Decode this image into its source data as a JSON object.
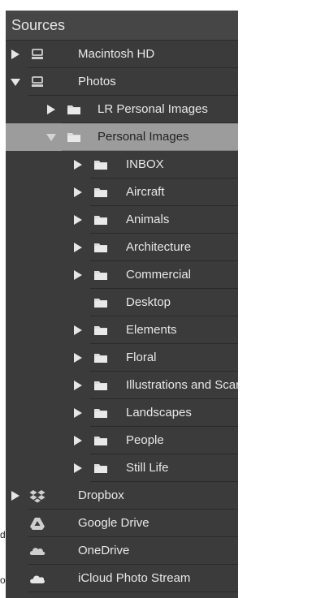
{
  "panel": {
    "title": "Sources"
  },
  "edge_text": {
    "left_a": "d",
    "left_b": "o"
  },
  "rows": [
    {
      "name": "macintosh-hd",
      "label": "Macintosh HD",
      "level": 0,
      "disclosure": "collapsed",
      "icon": "drive-icon"
    },
    {
      "name": "photos",
      "label": "Photos",
      "level": 0,
      "disclosure": "expanded",
      "icon": "drive-icon"
    },
    {
      "name": "lr-personal-images",
      "label": "LR Personal Images",
      "level": 1,
      "disclosure": "collapsed",
      "icon": "folder-icon"
    },
    {
      "name": "personal-images",
      "label": "Personal Images",
      "level": 1,
      "disclosure": "expanded",
      "icon": "folder-icon",
      "selected": true
    },
    {
      "name": "inbox",
      "label": "INBOX",
      "level": 2,
      "disclosure": "collapsed",
      "icon": "folder-icon"
    },
    {
      "name": "aircraft",
      "label": "Aircraft",
      "level": 2,
      "disclosure": "collapsed",
      "icon": "folder-icon"
    },
    {
      "name": "animals",
      "label": "Animals",
      "level": 2,
      "disclosure": "collapsed",
      "icon": "folder-icon"
    },
    {
      "name": "architecture",
      "label": "Architecture",
      "level": 2,
      "disclosure": "collapsed",
      "icon": "folder-icon"
    },
    {
      "name": "commercial",
      "label": "Commercial",
      "level": 2,
      "disclosure": "collapsed",
      "icon": "folder-icon"
    },
    {
      "name": "desktop",
      "label": "Desktop",
      "level": 2,
      "disclosure": "none",
      "icon": "folder-icon"
    },
    {
      "name": "elements",
      "label": "Elements",
      "level": 2,
      "disclosure": "collapsed",
      "icon": "folder-icon"
    },
    {
      "name": "floral",
      "label": "Floral",
      "level": 2,
      "disclosure": "collapsed",
      "icon": "folder-icon"
    },
    {
      "name": "illustrations-and-scans",
      "label": "Illustrations and Scans",
      "level": 2,
      "disclosure": "collapsed",
      "icon": "folder-icon"
    },
    {
      "name": "landscapes",
      "label": "Landscapes",
      "level": 2,
      "disclosure": "collapsed",
      "icon": "folder-icon"
    },
    {
      "name": "people",
      "label": "People",
      "level": 2,
      "disclosure": "collapsed",
      "icon": "folder-icon"
    },
    {
      "name": "still-life",
      "label": "Still Life",
      "level": 2,
      "disclosure": "collapsed",
      "icon": "folder-icon"
    },
    {
      "name": "dropbox",
      "label": "Dropbox",
      "level": 0,
      "disclosure": "collapsed",
      "icon": "dropbox-icon"
    },
    {
      "name": "google-drive",
      "label": "Google Drive",
      "level": 0,
      "disclosure": "none",
      "icon": "google-drive-icon"
    },
    {
      "name": "onedrive",
      "label": "OneDrive",
      "level": 0,
      "disclosure": "none",
      "icon": "onedrive-icon"
    },
    {
      "name": "icloud-photo-stream",
      "label": "iCloud Photo Stream",
      "level": 0,
      "disclosure": "none",
      "icon": "icloud-icon"
    }
  ]
}
